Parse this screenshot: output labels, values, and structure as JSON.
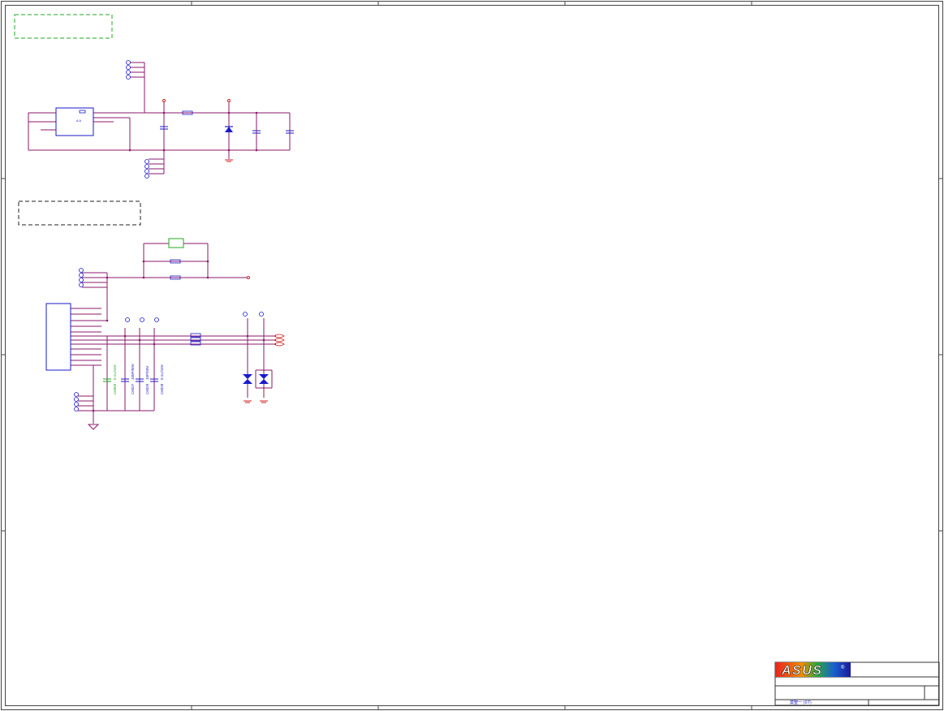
{
  "schematic": {
    "capacitor_labels": [
      {
        "ref": "C6009",
        "value": "0.1U/16V"
      },
      {
        "ref": "C6027",
        "value": "100P/50V"
      },
      {
        "ref": "C6029",
        "value": "10P/50V"
      },
      {
        "ref": "C6028",
        "value": "0.1U/16V"
      }
    ],
    "connector_text": "A  A",
    "pin_numbers": {
      "one": "1",
      "two": "2"
    },
    "colors": {
      "wire": "#8b1a6b",
      "component": "#1a1acc",
      "power": "#cc2222",
      "label_green": "#22aa22",
      "frame": "#333333"
    }
  },
  "title_block": {
    "logo": "ASUS",
    "registered_mark": "®",
    "footer_text": "莫聖一  (07)"
  }
}
